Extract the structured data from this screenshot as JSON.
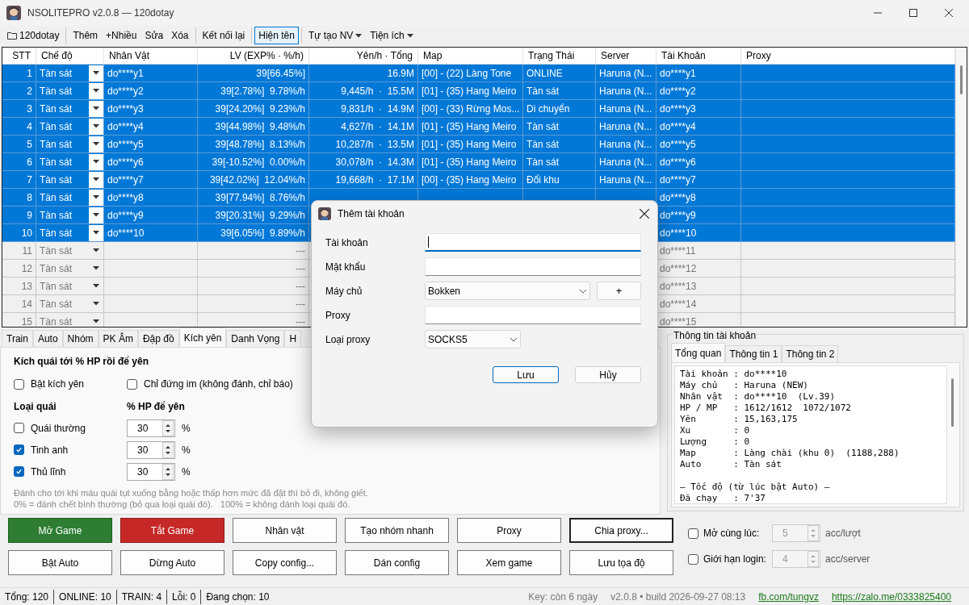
{
  "window": {
    "title": "NSOLITEPRO v2.0.8 — 120dotay"
  },
  "toolbar": {
    "groups": [
      [
        {
          "label": "120dotay",
          "kind": "folder",
          "selected": false
        }
      ],
      [
        {
          "label": "Thêm",
          "kind": "button",
          "selected": false
        },
        {
          "label": "+Nhiều",
          "kind": "button",
          "selected": false
        },
        {
          "label": "Sửa",
          "kind": "button",
          "selected": false
        },
        {
          "label": "Xóa",
          "kind": "button",
          "selected": false
        }
      ],
      [
        {
          "label": "Kết nối lại",
          "kind": "button",
          "selected": false
        }
      ],
      [
        {
          "label": "Hiện tên",
          "kind": "button",
          "selected": true
        }
      ],
      [
        {
          "label": "Tự tạo NV",
          "kind": "dropdown",
          "selected": false
        },
        {
          "label": "Tiện ích",
          "kind": "dropdown",
          "selected": false
        }
      ]
    ]
  },
  "grid": {
    "columns": [
      "STT",
      "Chế độ",
      "Nhân Vật",
      "LV (EXP% · %/h)",
      "Yên/h · Tổng",
      "Map",
      "Trạng Thái",
      "Server",
      "Tài Khoản",
      "Proxy"
    ],
    "rows": [
      {
        "stt": "1",
        "mode": "Tàn sát",
        "character": "do****y1",
        "lv": "39[66.45%]",
        "yen": "16.9M",
        "map": "[00] - (22) Làng Tone",
        "status": "ONLINE",
        "server": "Haruna (N...",
        "account": "do****y1",
        "selected": true
      },
      {
        "stt": "2",
        "mode": "Tàn sát",
        "character": "do****y2",
        "lv": "39[2.78%]  9.78%/h",
        "yen": "9,445/h  ·  15.5M",
        "map": "[01] - (35) Hang Meiro",
        "status": "Tàn sát",
        "server": "Haruna (N...",
        "account": "do****y2",
        "selected": true
      },
      {
        "stt": "3",
        "mode": "Tàn sát",
        "character": "do****y3",
        "lv": "39[24.20%]  9.23%/h",
        "yen": "9,831/h  ·  14.9M",
        "map": "[00] - (33) Rừng Mos...",
        "status": "Di chuyển",
        "server": "Haruna (N...",
        "account": "do****y3",
        "selected": true
      },
      {
        "stt": "4",
        "mode": "Tàn sát",
        "character": "do****y4",
        "lv": "39[44.98%]  9.48%/h",
        "yen": "4,627/h  ·  14.1M",
        "map": "[01] - (35) Hang Meiro",
        "status": "Tàn sát",
        "server": "Haruna (N...",
        "account": "do****y4",
        "selected": true
      },
      {
        "stt": "5",
        "mode": "Tàn sát",
        "character": "do****y5",
        "lv": "39[48.78%]  8.13%/h",
        "yen": "10,287/h  ·  13.5M",
        "map": "[01] - (35) Hang Meiro",
        "status": "Tàn sát",
        "server": "Haruna (N...",
        "account": "do****y5",
        "selected": true
      },
      {
        "stt": "6",
        "mode": "Tàn sát",
        "character": "do****y6",
        "lv": "39[-10.52%]  0.00%/h",
        "yen": "30,078/h  ·  14.3M",
        "map": "[01] - (35) Hang Meiro",
        "status": "Tàn sát",
        "server": "Haruna (N...",
        "account": "do****y6",
        "selected": true
      },
      {
        "stt": "7",
        "mode": "Tàn sát",
        "character": "do****y7",
        "lv": "39[42.02%]  12.04%/h",
        "yen": "19,668/h  ·  17.1M",
        "map": "[00] - (35) Hang Meiro",
        "status": "Đổi khu",
        "server": "Haruna (N...",
        "account": "do****y7",
        "selected": true
      },
      {
        "stt": "8",
        "mode": "Tàn sát",
        "character": "do****y8",
        "lv": "39[77.94%]  8.76%/h",
        "account": "do****y8",
        "selected": true
      },
      {
        "stt": "9",
        "mode": "Tàn sát",
        "character": "do****y9",
        "lv": "39[20.31%]  9.29%/h",
        "account": "do****y9",
        "selected": true
      },
      {
        "stt": "10",
        "mode": "Tàn sát",
        "character": "do****10",
        "lv": "39[6.05%]  9.89%/h",
        "account": "do****10",
        "selected": true
      },
      {
        "stt": "11",
        "mode": "Tàn sát",
        "lv": "---",
        "account": "do****11",
        "selected": false
      },
      {
        "stt": "12",
        "mode": "Tàn sát",
        "lv": "---",
        "account": "do****12",
        "selected": false
      },
      {
        "stt": "13",
        "mode": "Tàn sát",
        "lv": "---",
        "account": "do****13",
        "selected": false
      },
      {
        "stt": "14",
        "mode": "Tàn sát",
        "lv": "---",
        "account": "do****14",
        "selected": false
      },
      {
        "stt": "15",
        "mode": "Tàn sát",
        "lv": "---",
        "account": "do****15",
        "selected": false
      }
    ]
  },
  "tabs": [
    {
      "label": "Train",
      "selected": false
    },
    {
      "label": "Auto",
      "selected": false
    },
    {
      "label": "Nhóm",
      "selected": false
    },
    {
      "label": "PK Âm",
      "selected": false
    },
    {
      "label": "Đập đồ",
      "selected": false
    },
    {
      "label": "Kích yên",
      "selected": true
    },
    {
      "label": "Danh Vọng",
      "selected": false
    },
    {
      "label": "H",
      "selected": false
    }
  ],
  "panel": {
    "heading": "Kích quái tới % HP rồi để yên",
    "toggles": [
      {
        "label": "Bật kích yên",
        "checked": false
      },
      {
        "label": "Chỉ đứng im (không đánh, chỉ báo)",
        "checked": false
      }
    ],
    "type_header": "Loại quái",
    "hp_header": "% HP để yên",
    "monsters": [
      {
        "label": "Quái thường",
        "checked": false,
        "value": "30",
        "unit": "%"
      },
      {
        "label": "Tinh anh",
        "checked": true,
        "value": "30",
        "unit": "%"
      },
      {
        "label": "Thủ lĩnh",
        "checked": true,
        "value": "30",
        "unit": "%"
      }
    ],
    "notes": [
      "Đánh cho tới khi máu quái tụt xuống bằng hoặc thấp hơn mức đã đặt thì bỏ đi, không giết.",
      "0% = đánh chết bình thường (bỏ qua loại quái đó).   100% = không đánh loại quái đó."
    ]
  },
  "account_info": {
    "title": "Thông tin tài khoản",
    "tabs": [
      {
        "label": "Tổng quan",
        "selected": true
      },
      {
        "label": "Thông tin 1",
        "selected": false
      },
      {
        "label": "Thông tin 2",
        "selected": false
      }
    ],
    "sections": [
      [
        "Tài khoản : do****10",
        "Máy chủ   : Haruna (NEW)",
        "Nhân vật  : do****10  (Lv.39)",
        "HP / MP   : 1612/1612  1072/1072",
        "Yên       : 15,163,175",
        "Xu        : 0",
        "Lượng     : 0",
        "Map       : Làng chài (khu 0)  (1188,288)",
        "Auto      : Tàn sát"
      ],
      [
        "— Tốc độ (từ lúc bật Auto) —",
        "Đã chạy   : 7'37"
      ]
    ]
  },
  "actions": [
    [
      {
        "label": "Mở Game",
        "kind": "start",
        "focused": false
      },
      {
        "label": "Tắt Game",
        "kind": "stop",
        "focused": false
      },
      {
        "label": "Nhân vật",
        "kind": "normal",
        "focused": false
      },
      {
        "label": "Tạo nhóm nhanh",
        "kind": "normal",
        "focused": false
      },
      {
        "label": "Proxy",
        "kind": "normal",
        "focused": false
      },
      {
        "label": "Chia proxy...",
        "kind": "normal",
        "focused": true
      }
    ],
    [
      {
        "label": "Bật Auto",
        "kind": "normal",
        "focused": false
      },
      {
        "label": "Dừng Auto",
        "kind": "normal",
        "focused": false
      },
      {
        "label": "Copy config...",
        "kind": "normal",
        "focused": false
      },
      {
        "label": "Dán config",
        "kind": "normal",
        "focused": false
      },
      {
        "label": "Xem game",
        "kind": "normal",
        "focused": false
      },
      {
        "label": "Lưu tọa độ",
        "kind": "normal",
        "focused": false
      }
    ]
  ],
  "options": [
    {
      "label": "Mở cùng lúc:",
      "checked": false,
      "value": "5",
      "disabled": true,
      "unit": "acc/lượt"
    },
    {
      "label": "Giới hạn login:",
      "checked": false,
      "value": "4",
      "disabled": true,
      "unit": "acc/server"
    }
  ],
  "status_bar": {
    "left": [
      "Tổng: 120",
      "ONLINE: 10",
      "TRAIN: 4",
      "Lỗi: 0",
      "Đang chọn: 10"
    ],
    "key": "Key: còn 6 ngày",
    "build": "v2.0.8 • build 2026-09-27 08:13",
    "links": [
      "fb.com/tungvz",
      "https://zalo.me/0333825400"
    ]
  },
  "dialog": {
    "title": "Thêm tài khoản",
    "fields": [
      {
        "label": "Tài khoản",
        "kind": "text",
        "focused": true
      },
      {
        "label": "Mật khẩu",
        "kind": "text",
        "focused": false
      },
      {
        "label": "Máy chủ",
        "kind": "select",
        "value": "Bokken",
        "add": "+"
      },
      {
        "label": "Proxy",
        "kind": "text",
        "focused": false
      },
      {
        "label": "Loại proxy",
        "kind": "select",
        "value": "SOCKS5"
      }
    ],
    "buttons": [
      {
        "label": "Lưu",
        "default": true
      },
      {
        "label": "Hủy",
        "default": false
      }
    ]
  }
}
